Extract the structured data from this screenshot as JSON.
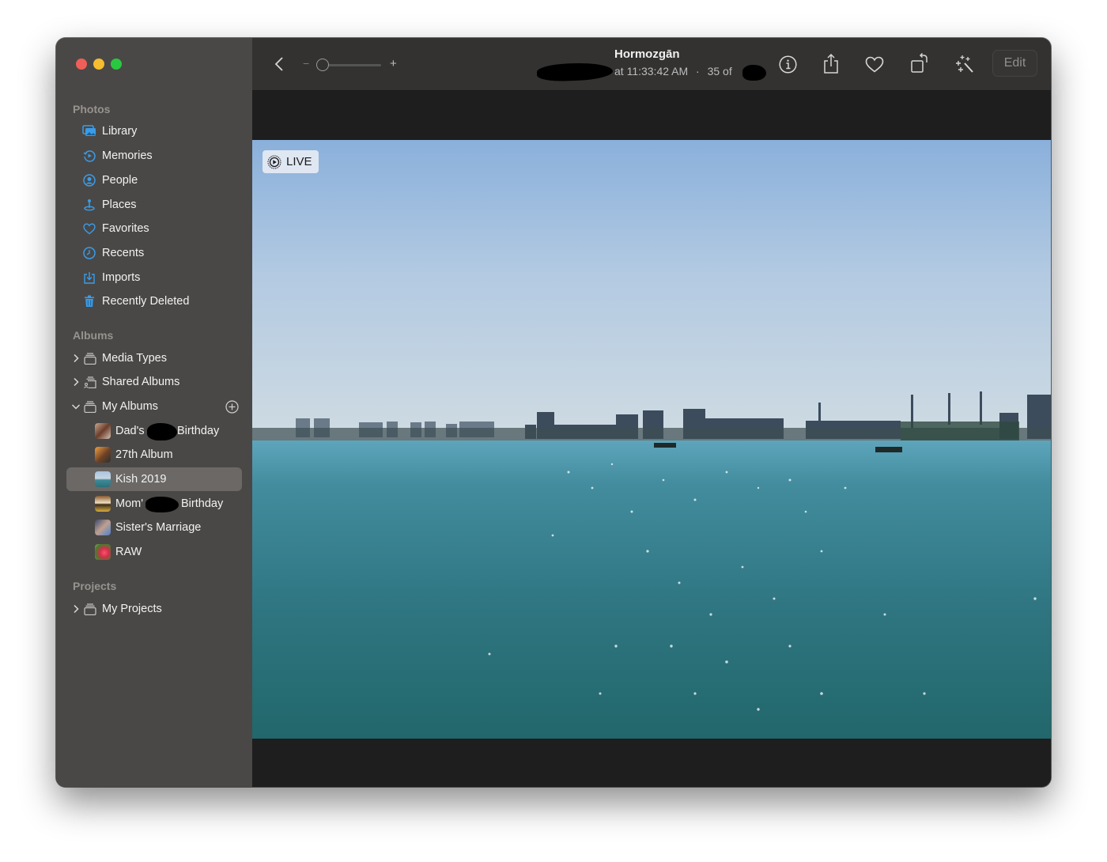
{
  "window": {
    "controls": [
      "close",
      "minimize",
      "zoom"
    ]
  },
  "sidebar": {
    "photos_section": {
      "label": "Photos",
      "items": [
        {
          "label": "Library",
          "icon": "library-icon"
        },
        {
          "label": "Memories",
          "icon": "memories-icon"
        },
        {
          "label": "People",
          "icon": "people-icon"
        },
        {
          "label": "Places",
          "icon": "places-icon"
        },
        {
          "label": "Favorites",
          "icon": "heart-icon"
        },
        {
          "label": "Recents",
          "icon": "clock-icon"
        },
        {
          "label": "Imports",
          "icon": "import-icon"
        },
        {
          "label": "Recently Deleted",
          "icon": "trash-icon"
        }
      ]
    },
    "albums_section": {
      "label": "Albums",
      "groups": [
        {
          "label": "Media Types",
          "expanded": false
        },
        {
          "label": "Shared Albums",
          "expanded": false
        },
        {
          "label": "My Albums",
          "expanded": true
        }
      ],
      "my_albums": [
        {
          "label_start": "Dad's",
          "label_end": "Birthday",
          "redacted": true
        },
        {
          "label": "27th Album"
        },
        {
          "label": "Kish 2019",
          "selected": true
        },
        {
          "label_start": "Mom'",
          "label_end": "Birthday",
          "redacted": true
        },
        {
          "label": "Sister's Marriage"
        },
        {
          "label": "RAW"
        }
      ]
    },
    "projects_section": {
      "label": "Projects",
      "groups": [
        {
          "label": "My Projects",
          "expanded": false
        }
      ]
    }
  },
  "toolbar": {
    "zoom_minus": "−",
    "zoom_plus": "+",
    "zoom_level": 0.0,
    "title": "Hormozgān",
    "subtitle_time": "at 11:33:42 AM",
    "subtitle_separator": "·",
    "subtitle_position": "35 of",
    "edit_label": "Edit"
  },
  "viewer": {
    "live_label": "LIVE"
  },
  "colors": {
    "accent": "#3a9ce8",
    "sidebar_bg": "#4a4846",
    "toolbar_bg": "#333231",
    "viewer_bg": "#1e1e1e",
    "selected_row": "#6b6866"
  }
}
